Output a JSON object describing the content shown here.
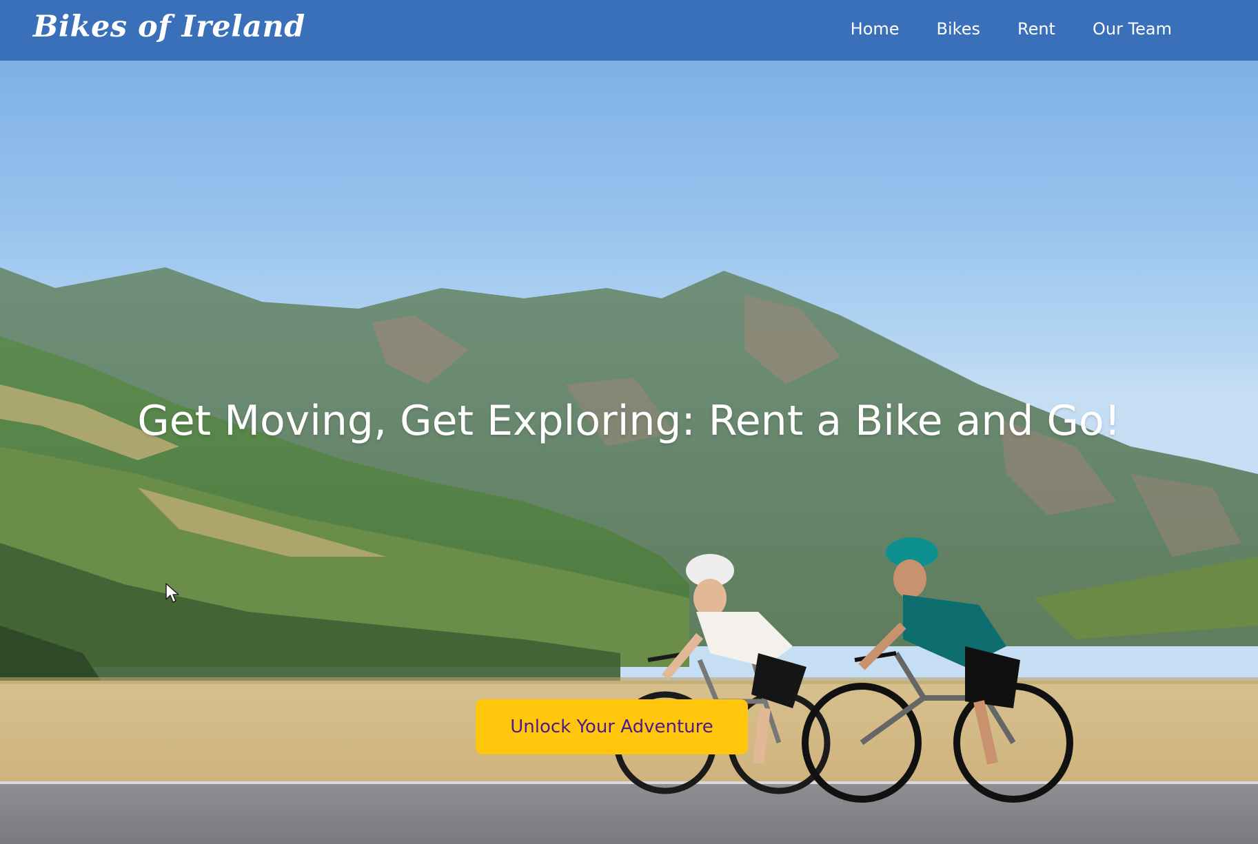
{
  "header": {
    "brand": "Bikes of Ireland",
    "nav": [
      {
        "label": "Home"
      },
      {
        "label": "Bikes"
      },
      {
        "label": "Rent"
      },
      {
        "label": "Our Team"
      }
    ]
  },
  "hero": {
    "title": "Get Moving, Get Exploring: Rent a Bike and Go!",
    "cta_label": "Unlock Your Adventure",
    "background": "photo of two cyclists on road bikes riding along a mountain road"
  },
  "colors": {
    "header_bg": "#3a6fba",
    "cta_bg": "#ffc60b",
    "cta_text": "#4b1a8c"
  }
}
